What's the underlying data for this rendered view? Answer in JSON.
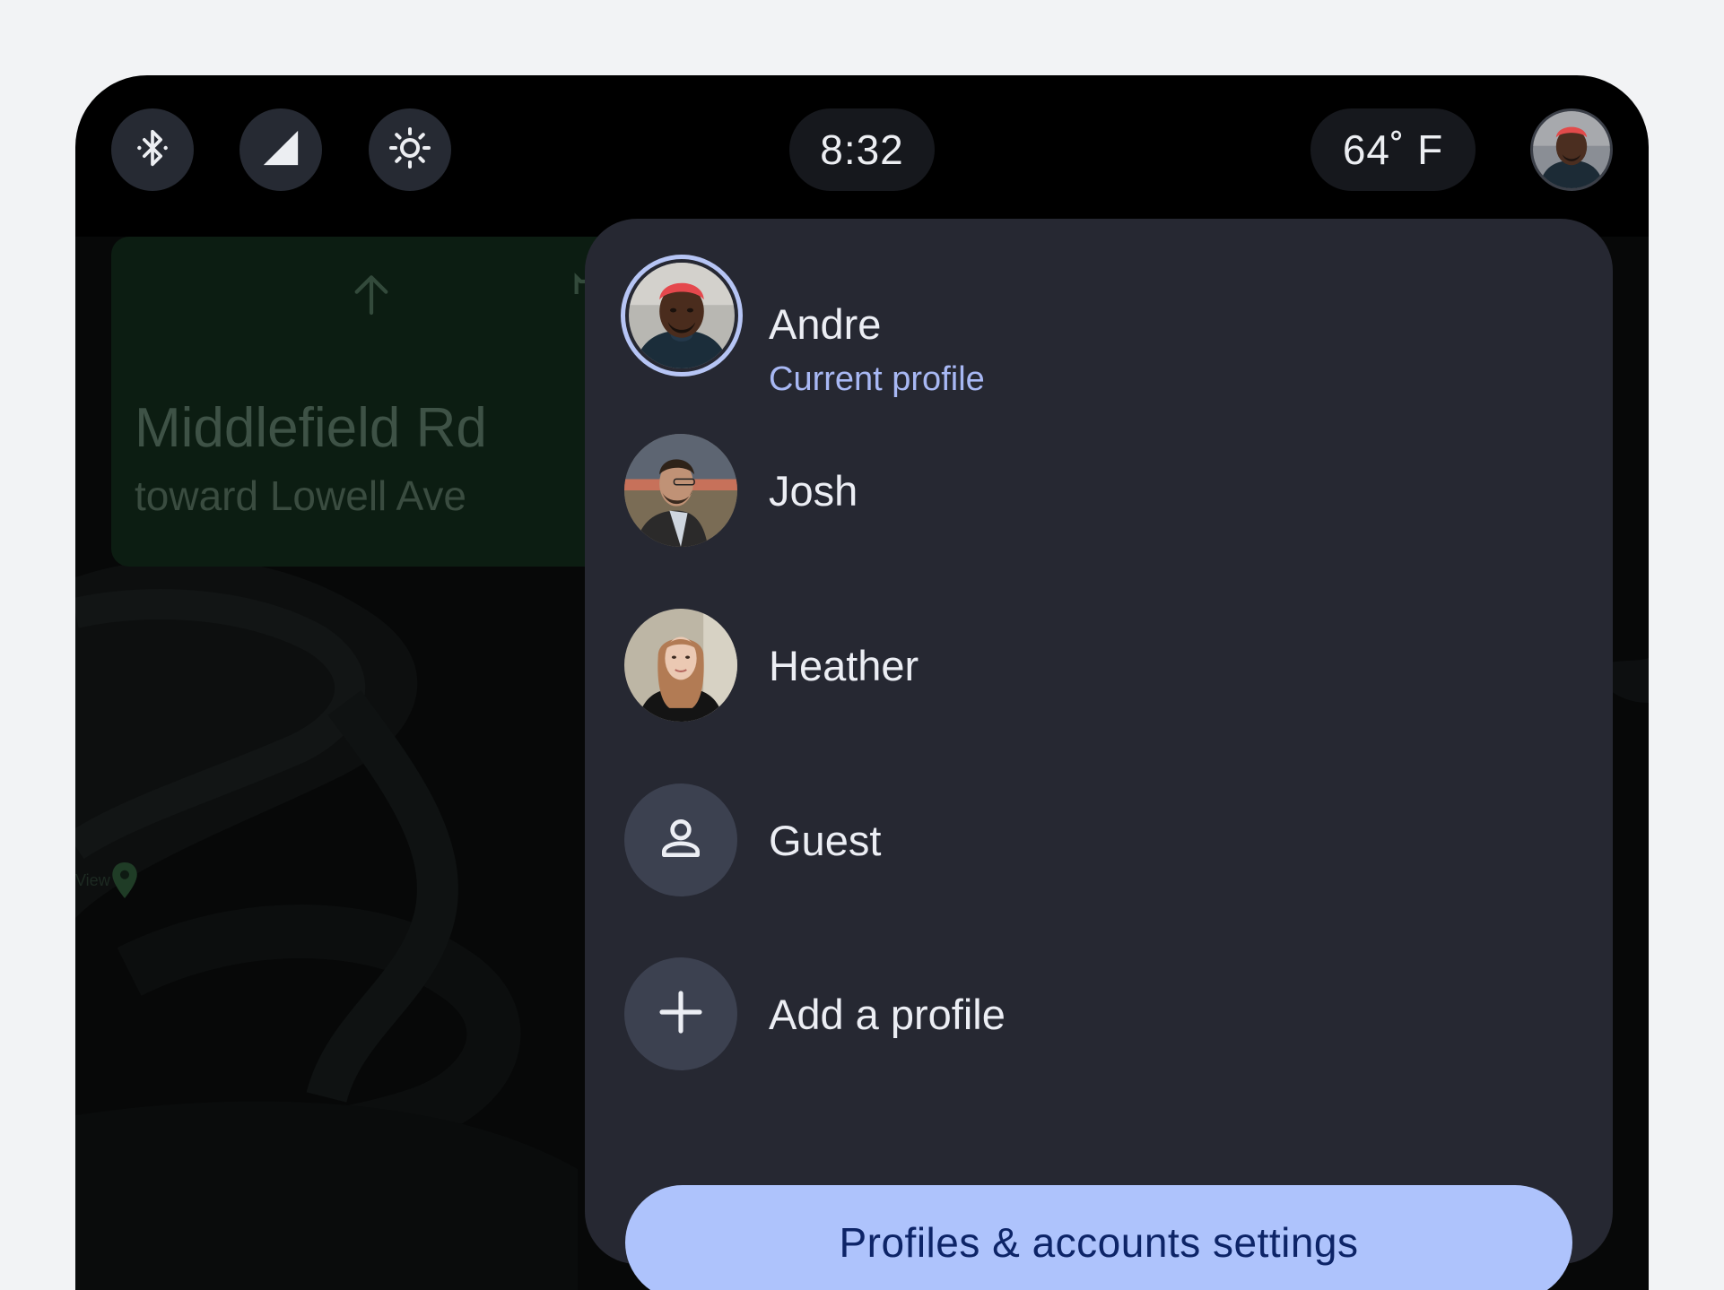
{
  "status_bar": {
    "clock": "8:32",
    "temperature": "64˚ F",
    "quick_settings": [
      {
        "icon": "bluetooth-icon"
      },
      {
        "icon": "signal-icon"
      },
      {
        "icon": "brightness-icon"
      }
    ],
    "profile_icon": "avatar"
  },
  "navigation": {
    "street": "Middlefield Rd",
    "toward": "toward Lowell Ave",
    "direction_icon": "arrow-up-icon",
    "poi_label": "View"
  },
  "profile_menu": {
    "current": {
      "name": "Andre",
      "subtitle": "Current profile"
    },
    "profiles": [
      {
        "name": "Josh"
      },
      {
        "name": "Heather"
      }
    ],
    "guest_label": "Guest",
    "add_label": "Add a profile",
    "settings_button": "Profiles & accounts settings",
    "colors": {
      "panel": "#262832",
      "accent": "#aec3fc",
      "accent_text": "#0d2467",
      "subtitle": "#a8b8f4"
    }
  }
}
